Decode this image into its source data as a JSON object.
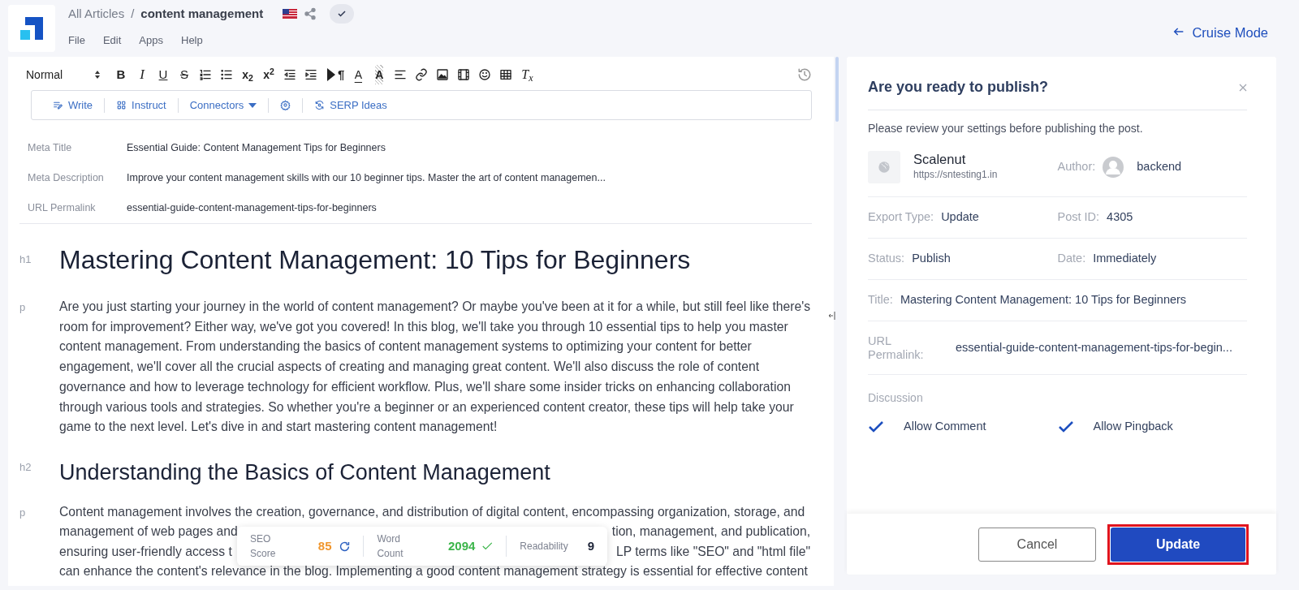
{
  "header": {
    "breadcrumb": {
      "parent": "All Articles",
      "separator": "/",
      "current": "content management"
    },
    "menu": [
      "File",
      "Edit",
      "Apps",
      "Help"
    ],
    "cruise_mode": "Cruise Mode"
  },
  "toolbar": {
    "format": "Normal",
    "buttons": [
      {
        "kind": "bold",
        "text": "B"
      },
      {
        "kind": "italic",
        "text": "I"
      },
      {
        "kind": "underline",
        "text": "U"
      },
      {
        "kind": "strike",
        "text": "S"
      },
      {
        "kind": "ordered-list"
      },
      {
        "kind": "bullet-list"
      },
      {
        "kind": "subscript",
        "text": "x$_{2}$"
      },
      {
        "kind": "superscript",
        "text": "x$^{2}$"
      },
      {
        "kind": "outdent"
      },
      {
        "kind": "indent"
      },
      {
        "kind": "direction",
        "text": "¶"
      },
      {
        "kind": "text-color",
        "text": "A"
      },
      {
        "kind": "highlight",
        "text": "A"
      },
      {
        "kind": "align"
      },
      {
        "kind": "link"
      },
      {
        "kind": "image"
      },
      {
        "kind": "video"
      },
      {
        "kind": "emoji"
      },
      {
        "kind": "table"
      },
      {
        "kind": "clear-format",
        "text": "T$_{x}$"
      }
    ]
  },
  "ai_bar": [
    {
      "kind": "write",
      "label": "Write"
    },
    {
      "kind": "instruct",
      "label": "Instruct"
    },
    {
      "kind": "connectors",
      "label": "Connectors"
    },
    {
      "kind": "settings"
    },
    {
      "kind": "serp",
      "label": "SERP Ideas"
    }
  ],
  "meta": [
    {
      "label": "Meta Title",
      "value": "Essential Guide: Content Management Tips for Beginners"
    },
    {
      "label": "Meta Description",
      "value": "Improve your content management skills with our 10 beginner tips. Master the art of content managemen..."
    },
    {
      "label": "URL Permalink",
      "value": "essential-guide-content-management-tips-for-beginners"
    }
  ],
  "blocks": [
    {
      "tag": "h1",
      "kind": "heading1",
      "text": "Mastering Content Management: 10 Tips for Beginners"
    },
    {
      "tag": "p",
      "kind": "paragraph",
      "text": "Are you just starting your journey in the world of content management? Or maybe you've been at it for a while, but still feel like there's room for improvement? Either way, we've got you covered! In this blog, we'll take you through 10 essential tips to help you master content management. From understanding the basics of content management systems to optimizing your content for better engagement, we'll cover all the crucial aspects of creating and managing great content. We'll also discuss the role of content governance and how to leverage technology for efficient workflow. Plus, we'll share some insider tricks on enhancing collaboration through various tools and strategies. So whether you're a beginner or an experienced content creator, these tips will help take your game to the next level. Let's dive in and start mastering content management!"
    },
    {
      "tag": "h2",
      "kind": "heading2",
      "text": "Understanding the Basics of Content Management"
    },
    {
      "tag": "p",
      "kind": "lines",
      "lines": [
        {
          "left": "Content management involves the creation, governance, and distribution of digital content, encompassing organization, storage, and"
        },
        {
          "left": "management of web pages and",
          "right": "tion, management, and publication,"
        },
        {
          "left": "ensuring user-friendly access t",
          "right": "LP terms like \"SEO\" and \"html file\""
        },
        {
          "left": "can enhance the content's relevance in the blog. Implementing a good content management strategy is essential for effective content"
        }
      ]
    }
  ],
  "score_bar": [
    {
      "label": "SEO Score",
      "value": "85",
      "color": "#f0962e",
      "kind": "refresh"
    },
    {
      "label": "Word Count",
      "value": "2094",
      "color": "#3bb54a",
      "kind": "check"
    },
    {
      "label": "Readability",
      "value": "9",
      "color": "#1b2236",
      "kind": "plain"
    }
  ],
  "publish": {
    "title": "Are you ready to publish?",
    "subtitle": "Please review your settings before publishing the post.",
    "site": {
      "name": "Scalenut",
      "url": "https://sntesting1.in"
    },
    "author": {
      "label": "Author:",
      "value": "backend"
    },
    "rows": [
      [
        {
          "label": "Export Type:",
          "value": "Update"
        },
        {
          "label": "Post ID:",
          "value": "4305"
        }
      ],
      [
        {
          "label": "Status:",
          "value": "Publish"
        },
        {
          "label": "Date:",
          "value": "Immediately"
        }
      ],
      [
        {
          "label": "Title:",
          "value": "Mastering Content Management: 10 Tips for Beginners"
        }
      ],
      [
        {
          "label": "URL Permalink:",
          "value": "essential-guide-content-management-tips-for-begin..."
        }
      ]
    ],
    "discussion": {
      "label": "Discussion",
      "options": [
        {
          "label": "Allow Comment",
          "checked": true
        },
        {
          "label": "Allow Pingback",
          "checked": true
        }
      ]
    },
    "buttons": [
      {
        "label": "Cancel",
        "kind": "secondary",
        "highlighted": false
      },
      {
        "label": "Update",
        "kind": "primary",
        "highlighted": true
      }
    ]
  }
}
